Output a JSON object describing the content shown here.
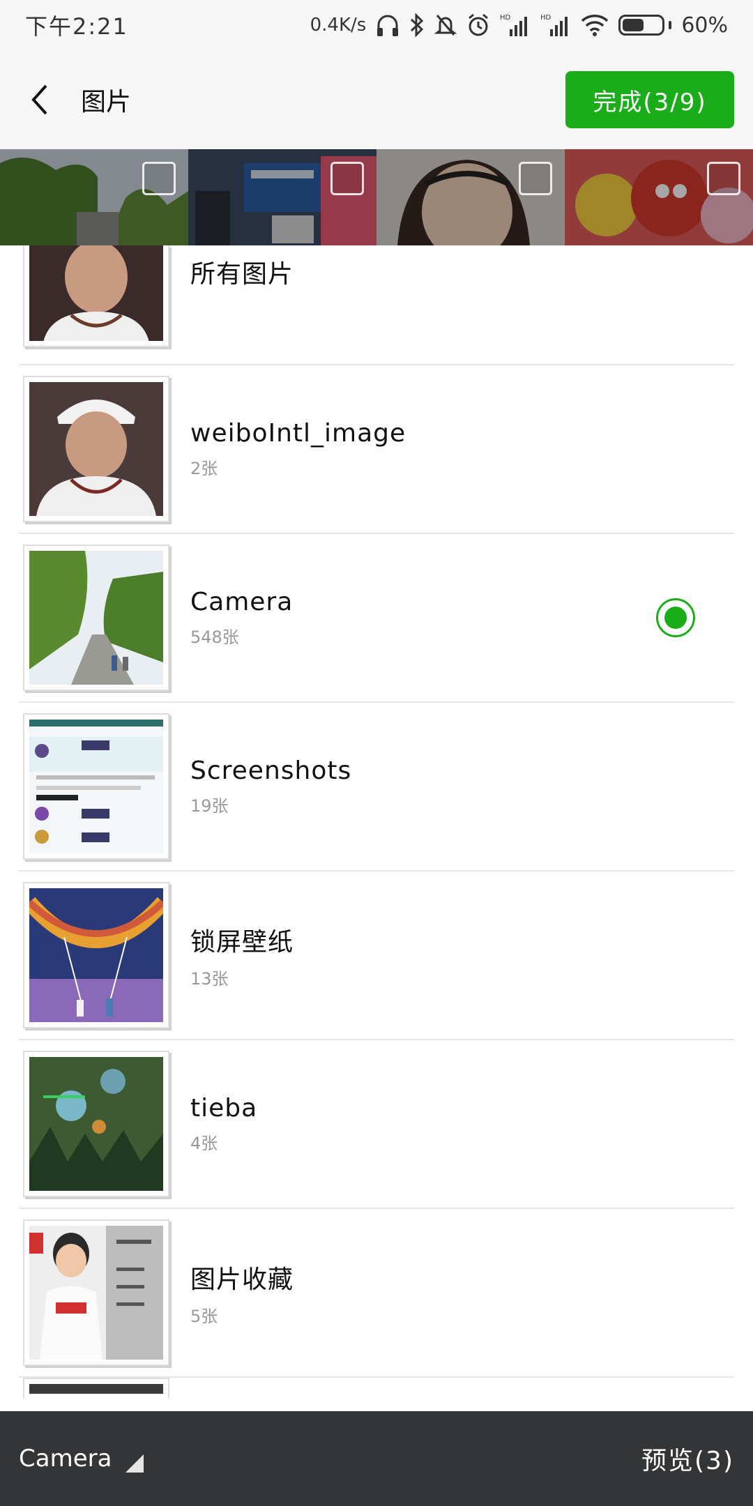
{
  "status_bar": {
    "time": "下午2:21",
    "net_speed": "0.4K/s",
    "icons": [
      "headphones-icon",
      "bluetooth-icon",
      "mute-icon",
      "alarm-icon",
      "hd-signal-icon",
      "hd-signal-icon",
      "wifi-icon",
      "battery-icon"
    ],
    "battery_level": 0.6,
    "battery_text": "60%"
  },
  "header": {
    "title": "图片",
    "done_label": "完成(3/9)",
    "accent": "#1aad19"
  },
  "strip": {
    "photos": [
      {
        "name": "trees-photo",
        "selected": false
      },
      {
        "name": "poster-photo",
        "selected": false
      },
      {
        "name": "girl-photo",
        "selected": false
      },
      {
        "name": "angry-birds-photo",
        "selected": false
      }
    ]
  },
  "albums": [
    {
      "name": "所有图片",
      "count": "",
      "selected": false,
      "thumb": "portrait-1"
    },
    {
      "name": "weiboIntl_image",
      "count": "2张",
      "selected": false,
      "thumb": "portrait-2"
    },
    {
      "name": "Camera",
      "count": "548张",
      "selected": true,
      "thumb": "road-trees"
    },
    {
      "name": "Screenshots",
      "count": "19张",
      "selected": false,
      "thumb": "game-list"
    },
    {
      "name": "锁屏壁纸",
      "count": "13张",
      "selected": false,
      "thumb": "wallpaper"
    },
    {
      "name": "tieba",
      "count": "4张",
      "selected": false,
      "thumb": "game-scene"
    },
    {
      "name": "图片收藏",
      "count": "5张",
      "selected": false,
      "thumb": "player"
    }
  ],
  "bottom_bar": {
    "folder_label": "Camera",
    "preview_label": "预览(3)"
  }
}
